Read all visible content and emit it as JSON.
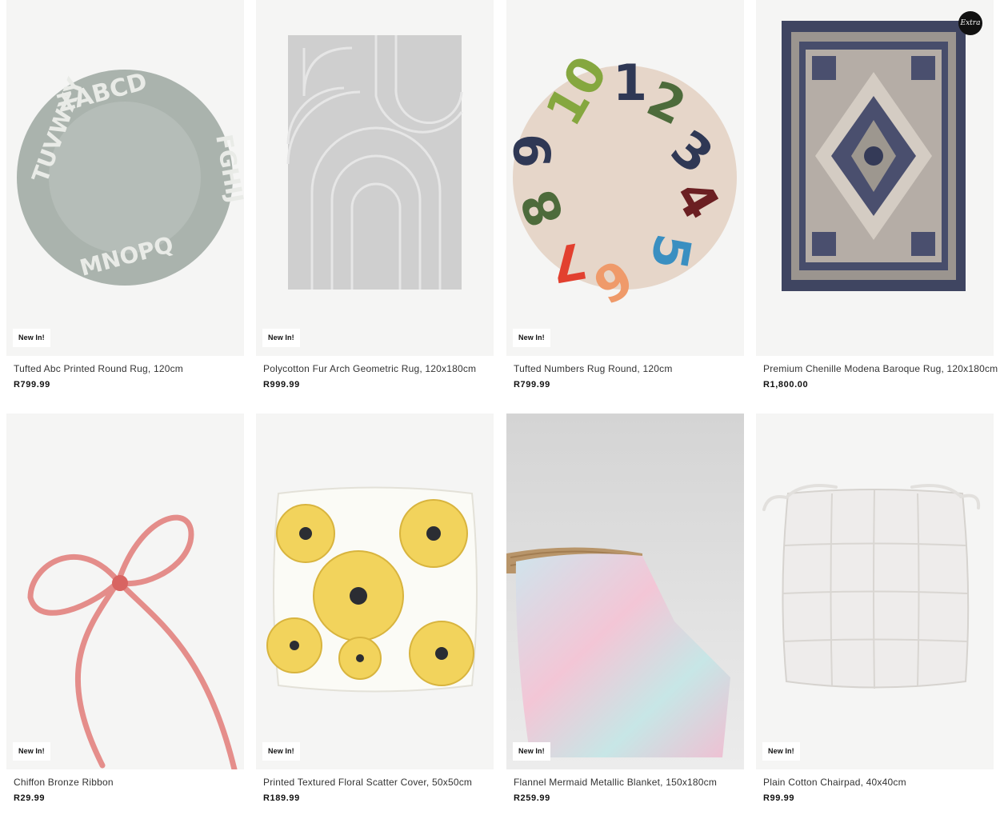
{
  "products": [
    {
      "name": "Tufted Abc Printed Round Rug, 120cm",
      "price": "R799.99",
      "badge": "New In!",
      "image_icon": "round-alphabet-rug"
    },
    {
      "name": "Polycotton Fur Arch Geometric Rug, 120x180cm",
      "price": "R999.99",
      "badge": "New In!",
      "image_icon": "grey-arch-rug"
    },
    {
      "name": "Tufted Numbers Rug Round, 120cm",
      "price": "R799.99",
      "badge": "New In!",
      "image_icon": "round-numbers-rug"
    },
    {
      "name": "Premium Chenille Modena Baroque Rug, 120x180cm",
      "price": "R1,800.00",
      "badge": "",
      "extra_badge": "Extra",
      "image_icon": "baroque-rug"
    },
    {
      "name": "Chiffon Bronze Ribbon",
      "price": "R29.99",
      "badge": "New In!",
      "image_icon": "pink-ribbon"
    },
    {
      "name": "Printed Textured Floral Scatter Cover, 50x50cm",
      "price": "R189.99",
      "badge": "New In!",
      "image_icon": "floral-cushion"
    },
    {
      "name": "Flannel Mermaid Metallic Blanket, 150x180cm",
      "price": "R259.99",
      "badge": "New In!",
      "image_icon": "pastel-blanket"
    },
    {
      "name": "Plain Cotton Chairpad, 40x40cm",
      "price": "R99.99",
      "badge": "New In!",
      "image_icon": "white-chairpad"
    }
  ]
}
